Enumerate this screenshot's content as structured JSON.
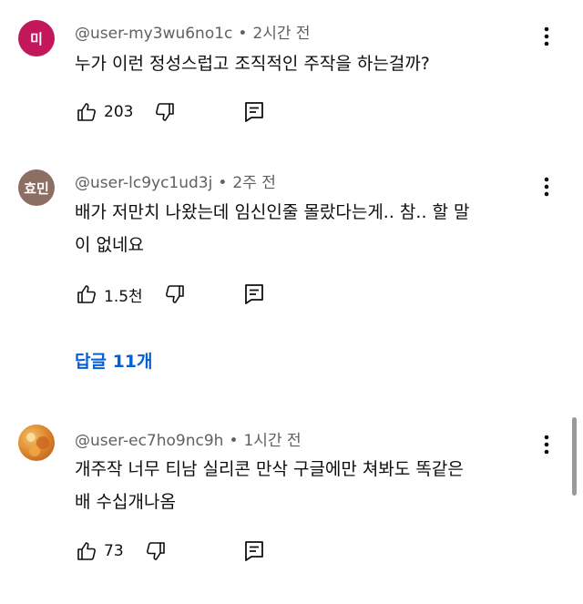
{
  "comments": [
    {
      "avatar_text": "미",
      "avatar_color": "#c2185b",
      "username": "@user-my3wu6no1c",
      "time": "2시간 전",
      "text_lines": [
        "누가 이런 정성스럽고 조직적인 주작을 하는걸까?"
      ],
      "likes": "203"
    },
    {
      "avatar_text": "효민",
      "avatar_color": "#8d6e63",
      "username": "@user-lc9yc1ud3j",
      "time": "2주 전",
      "text_lines": [
        "배가 저만치 나왔는데 임신인줄 몰랐다는게.. 참.. 할 말",
        "이 없네요"
      ],
      "likes": "1.5천",
      "replies_label": "답글 11개"
    },
    {
      "avatar_text": "",
      "avatar_color": "#d9822b",
      "username": "@user-ec7ho9nc9h",
      "time": "1시간 전",
      "text_lines": [
        "개주작 너무 티남 실리콘 만삭 구글에만 쳐봐도 똑같은",
        "배 수십개나옴"
      ],
      "likes": "73"
    }
  ],
  "meta_separator": "•",
  "icons": {
    "like": "thumb-up-icon",
    "dislike": "thumb-down-icon",
    "reply": "reply-icon",
    "more": "more-vert-icon"
  },
  "colors": {
    "link": "#065fd4",
    "meta": "#606060",
    "text": "#0f0f0f"
  }
}
